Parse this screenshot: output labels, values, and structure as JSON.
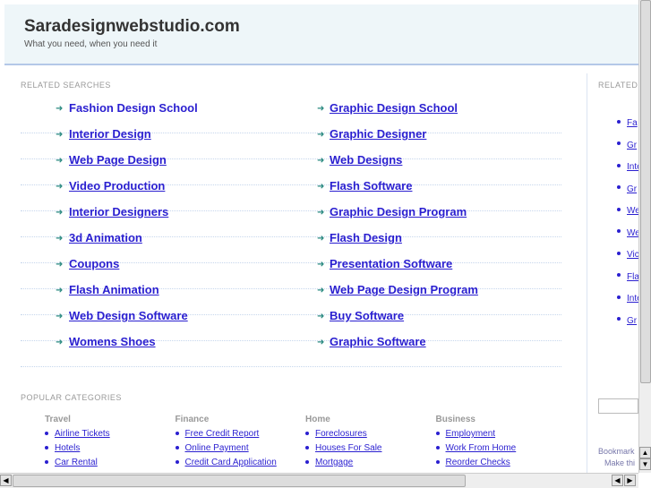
{
  "header": {
    "title": "Saradesignwebstudio.com",
    "tagline": "What you need, when you need it"
  },
  "related": {
    "label": "RELATED SEARCHES",
    "left": [
      "Fashion Design School",
      "Interior Design",
      "Web Page Design",
      "Video Production",
      "Interior Designers",
      "3d Animation",
      "Coupons",
      "Flash Animation",
      "Web Design Software",
      "Womens Shoes"
    ],
    "right": [
      "Graphic Design School",
      "Graphic Designer",
      "Web Designs",
      "Flash Software",
      "Graphic Design Program",
      "Flash Design",
      "Presentation Software",
      "Web Page Design Program",
      "Buy Software",
      "Graphic Software"
    ]
  },
  "popular": {
    "label": "POPULAR CATEGORIES",
    "cats": [
      {
        "title": "Travel",
        "items": [
          "Airline Tickets",
          "Hotels",
          "Car Rental"
        ]
      },
      {
        "title": "Finance",
        "items": [
          "Free Credit Report",
          "Online Payment",
          "Credit Card Application"
        ]
      },
      {
        "title": "Home",
        "items": [
          "Foreclosures",
          "Houses For Sale",
          "Mortgage"
        ]
      },
      {
        "title": "Business",
        "items": [
          "Employment",
          "Work From Home",
          "Reorder Checks"
        ]
      }
    ]
  },
  "sidebar": {
    "label": "RELATED",
    "items": [
      "Fa",
      "Gr",
      "Inte",
      "Gr",
      "We",
      "We",
      "Vic",
      "Fla",
      "Inte",
      "Gr"
    ],
    "bookmark": "Bookmark",
    "make": "Make thi"
  }
}
